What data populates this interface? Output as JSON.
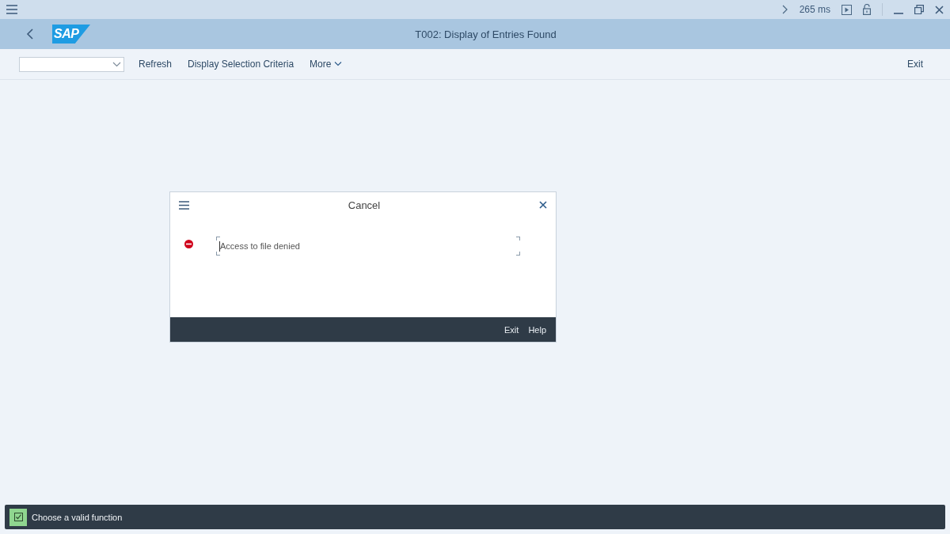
{
  "titlebar": {
    "timing": "265 ms"
  },
  "header": {
    "logo": "SAP",
    "title": "T002: Display of Entries Found"
  },
  "toolbar": {
    "items": [
      {
        "label": "Refresh"
      },
      {
        "label": "Display Selection Criteria"
      }
    ],
    "more": "More",
    "exit": "Exit"
  },
  "dialog": {
    "title": "Cancel",
    "message": {
      "kind": "error",
      "text": "Access to file denied"
    },
    "buttons": [
      "Exit",
      "Help"
    ]
  },
  "status_bar": {
    "kind": "success",
    "text": "Choose a valid function"
  }
}
